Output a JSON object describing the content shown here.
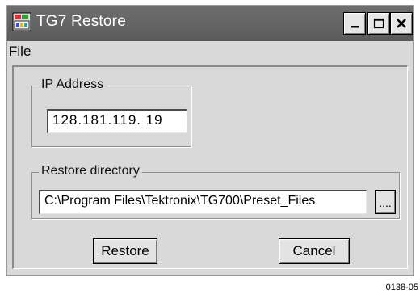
{
  "window": {
    "title": "TG7 Restore",
    "buttons": {
      "minimize_glyph": "_",
      "close_glyph": "✕"
    },
    "icons": [
      "app-icon",
      "minimize-icon",
      "maximize-icon",
      "close-icon"
    ]
  },
  "menu": {
    "file_label": "File"
  },
  "ip_group": {
    "label": "IP Address",
    "value": "128.181.119. 19"
  },
  "dir_group": {
    "label": "Restore directory",
    "value": "C:\\Program Files\\Tektronix\\TG700\\Preset_Files",
    "browse_label": "...."
  },
  "actions": {
    "restore_label": "Restore",
    "cancel_label": "Cancel"
  },
  "figure_id": "0138-05",
  "colors": {
    "titlebar": "#666666",
    "window_bg": "#d9d9d9",
    "field_bg": "#ffffff"
  }
}
